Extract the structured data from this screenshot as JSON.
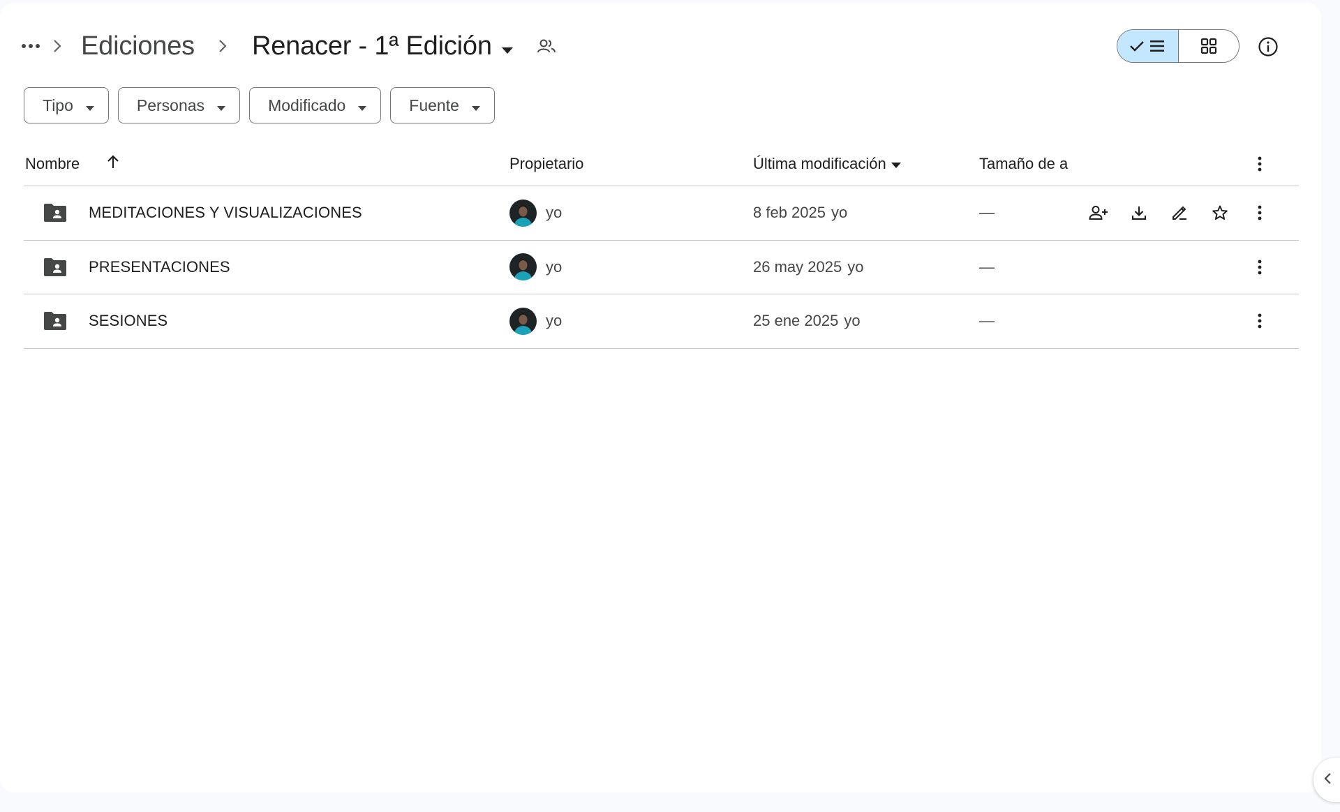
{
  "breadcrumb": {
    "parent": "Ediciones",
    "current": "Renacer - 1ª Edición"
  },
  "view_toggle": {
    "active": "list"
  },
  "filters": [
    {
      "label": "Tipo"
    },
    {
      "label": "Personas"
    },
    {
      "label": "Modificado"
    },
    {
      "label": "Fuente"
    }
  ],
  "table": {
    "headers": {
      "name": "Nombre",
      "owner": "Propietario",
      "modified": "Última modificación",
      "size": "Tamaño de a"
    },
    "sort": {
      "column": "name",
      "direction": "ascending"
    },
    "rows": [
      {
        "name": "MEDITACIONES Y VISUALIZACIONES",
        "owner": "yo",
        "modified_date": "8 feb 2025",
        "modified_by": "yo",
        "size": "—",
        "hovered": true
      },
      {
        "name": "PRESENTACIONES",
        "owner": "yo",
        "modified_date": "26 may 2025",
        "modified_by": "yo",
        "size": "—",
        "hovered": false
      },
      {
        "name": "SESIONES",
        "owner": "yo",
        "modified_date": "25 ene 2025",
        "modified_by": "yo",
        "size": "—",
        "hovered": false
      }
    ]
  },
  "icons": {
    "folder": "shared-folder-icon",
    "row_actions": [
      "share-icon",
      "download-icon",
      "rename-icon",
      "star-icon"
    ]
  },
  "colors": {
    "toggle_active": "#c2e7ff",
    "folder": "#444746",
    "divider": "#c4c7c5"
  }
}
